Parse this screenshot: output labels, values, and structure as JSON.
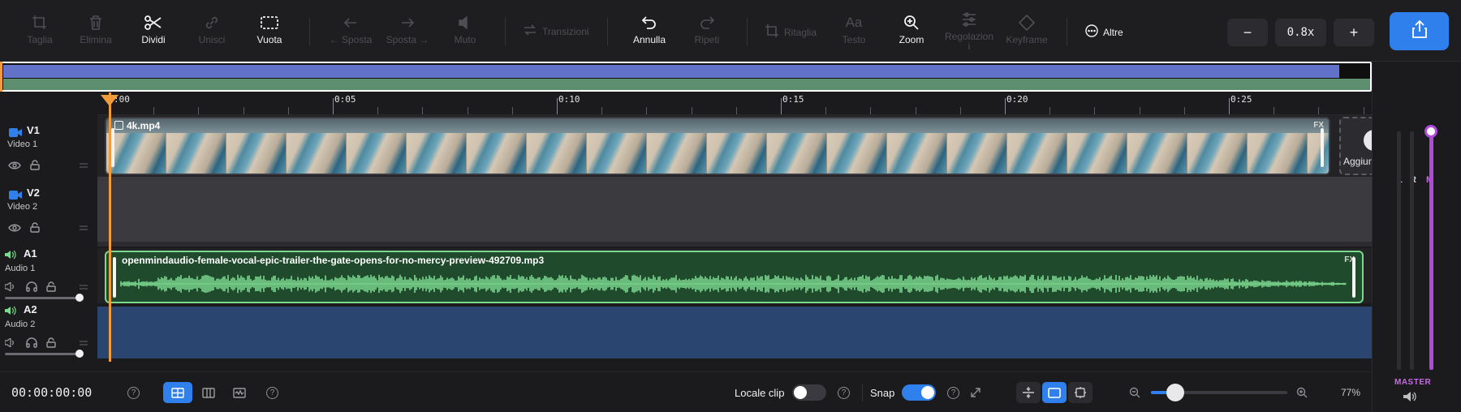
{
  "toolbar": {
    "buttons": [
      {
        "label": "Taglia",
        "icon": "crop-cut-icon",
        "enabled": false
      },
      {
        "label": "Elimina",
        "icon": "trash-icon",
        "enabled": false
      },
      {
        "label": "Dividi",
        "icon": "scissors-icon",
        "enabled": true
      },
      {
        "label": "Unisci",
        "icon": "link-icon",
        "enabled": false
      },
      {
        "label": "Vuota",
        "icon": "dashed-rect-icon",
        "enabled": true
      }
    ],
    "move_left": "← Sposta",
    "move_right": "Sposta →",
    "mute": "Muto",
    "transitions": "Transizioni",
    "undo": "Annulla",
    "redo": "Ripeti",
    "crop": "Ritaglia",
    "text": "Testo",
    "zoom": "Zoom",
    "adjust": "Regolazion",
    "adjust_line2": "i",
    "keyframe": "Keyframe",
    "more": "Altre",
    "zoom_minus": "−",
    "zoom_value": "0.8x",
    "zoom_plus": "+"
  },
  "ruler": {
    "labels": [
      ":00",
      "0:05",
      "0:10",
      "0:15",
      "0:20",
      "0:25"
    ]
  },
  "tracks": {
    "v1": {
      "name": "V1",
      "sub": "Video 1"
    },
    "v2": {
      "name": "V2",
      "sub": "Video 2"
    },
    "a1": {
      "name": "A1",
      "sub": "Audio 1",
      "volume": 1.0
    },
    "a2": {
      "name": "A2",
      "sub": "Audio 2",
      "volume": 1.0
    }
  },
  "clips": {
    "video": {
      "name": "4k.mp4",
      "fx": "FX"
    },
    "audio": {
      "name": "openmindaudio-female-vocal-epic-trailer-the-gate-opens-for-no-mercy-preview-492709.mp3",
      "fx": "FX"
    },
    "add_label": "Aggiun"
  },
  "mixer": {
    "l": "L",
    "r": "R",
    "m": "M",
    "master": "MASTER",
    "level": 1.0
  },
  "bottom": {
    "timecode": "00:00:00:00",
    "help": "?",
    "local_clip": "Locale clip",
    "local_clip_on": false,
    "snap": "Snap",
    "snap_on": true,
    "zoom_percent": "77%",
    "zoom_slider": 0.18
  },
  "colors": {
    "accent": "#2f80ed",
    "playhead": "#f29b3a",
    "audio_wave": "#7bd88f",
    "master": "#b04ad8"
  }
}
